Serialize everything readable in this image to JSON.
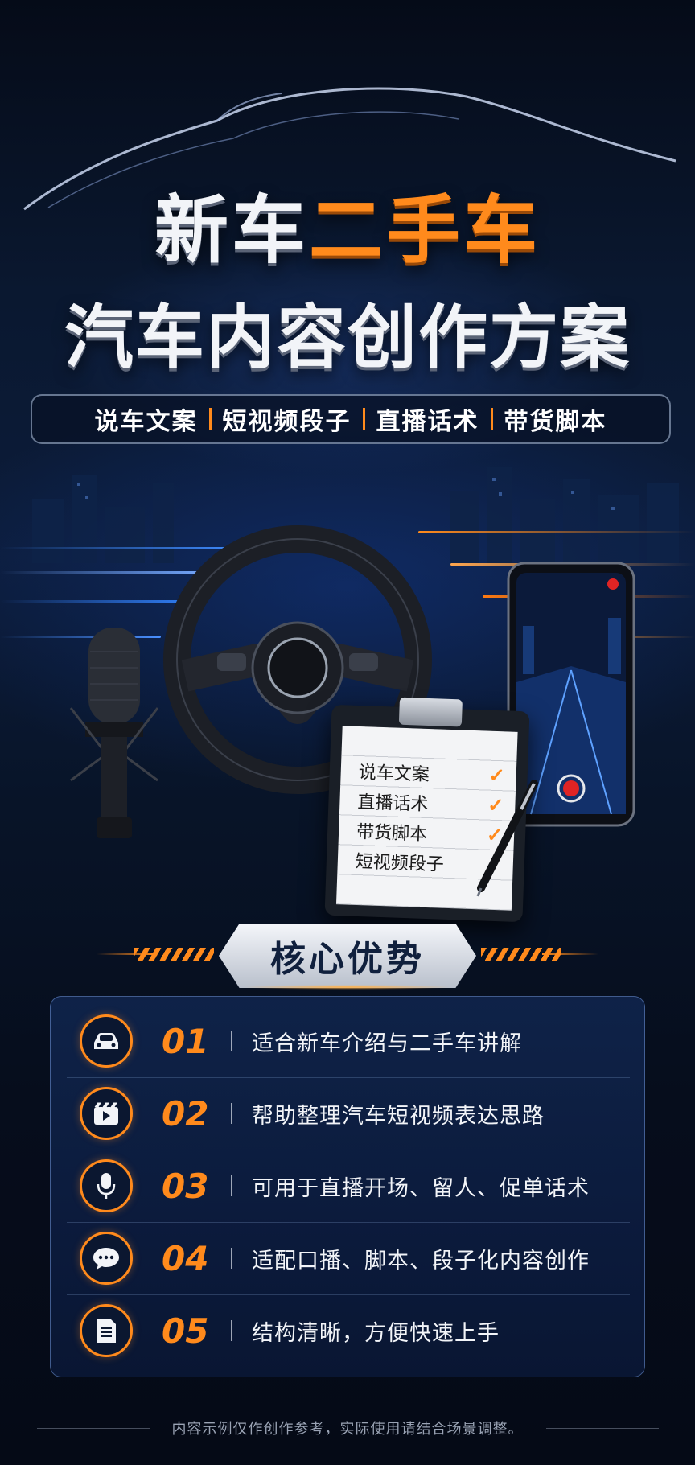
{
  "header": {
    "title_line1_white": "新车",
    "title_line1_orange": "二手车",
    "title_line2": "汽车内容创作方案"
  },
  "tags": [
    "说车文案",
    "短视频段子",
    "直播话术",
    "带货脚本"
  ],
  "clipboard": {
    "items": [
      "说车文案",
      "直播话术",
      "带货脚本",
      "短视频段子"
    ],
    "check": "✓"
  },
  "advantages": {
    "heading": "核心优势",
    "items": [
      {
        "num": "01",
        "icon": "car-icon",
        "text": "适合新车介绍与二手车讲解"
      },
      {
        "num": "02",
        "icon": "video-icon",
        "text": "帮助整理汽车短视频表达思路"
      },
      {
        "num": "03",
        "icon": "microphone-icon",
        "text": "可用于直播开场、留人、促单话术"
      },
      {
        "num": "04",
        "icon": "chat-icon",
        "text": "适配口播、脚本、段子化内容创作"
      },
      {
        "num": "05",
        "icon": "document-icon",
        "text": "结构清晰，方便快速上手"
      }
    ]
  },
  "footer": {
    "note": "内容示例仅作创作参考，实际使用请结合场景调整。"
  },
  "colors": {
    "accent": "#ff8a1c",
    "background": "#07101f",
    "panel": "#10244c"
  }
}
